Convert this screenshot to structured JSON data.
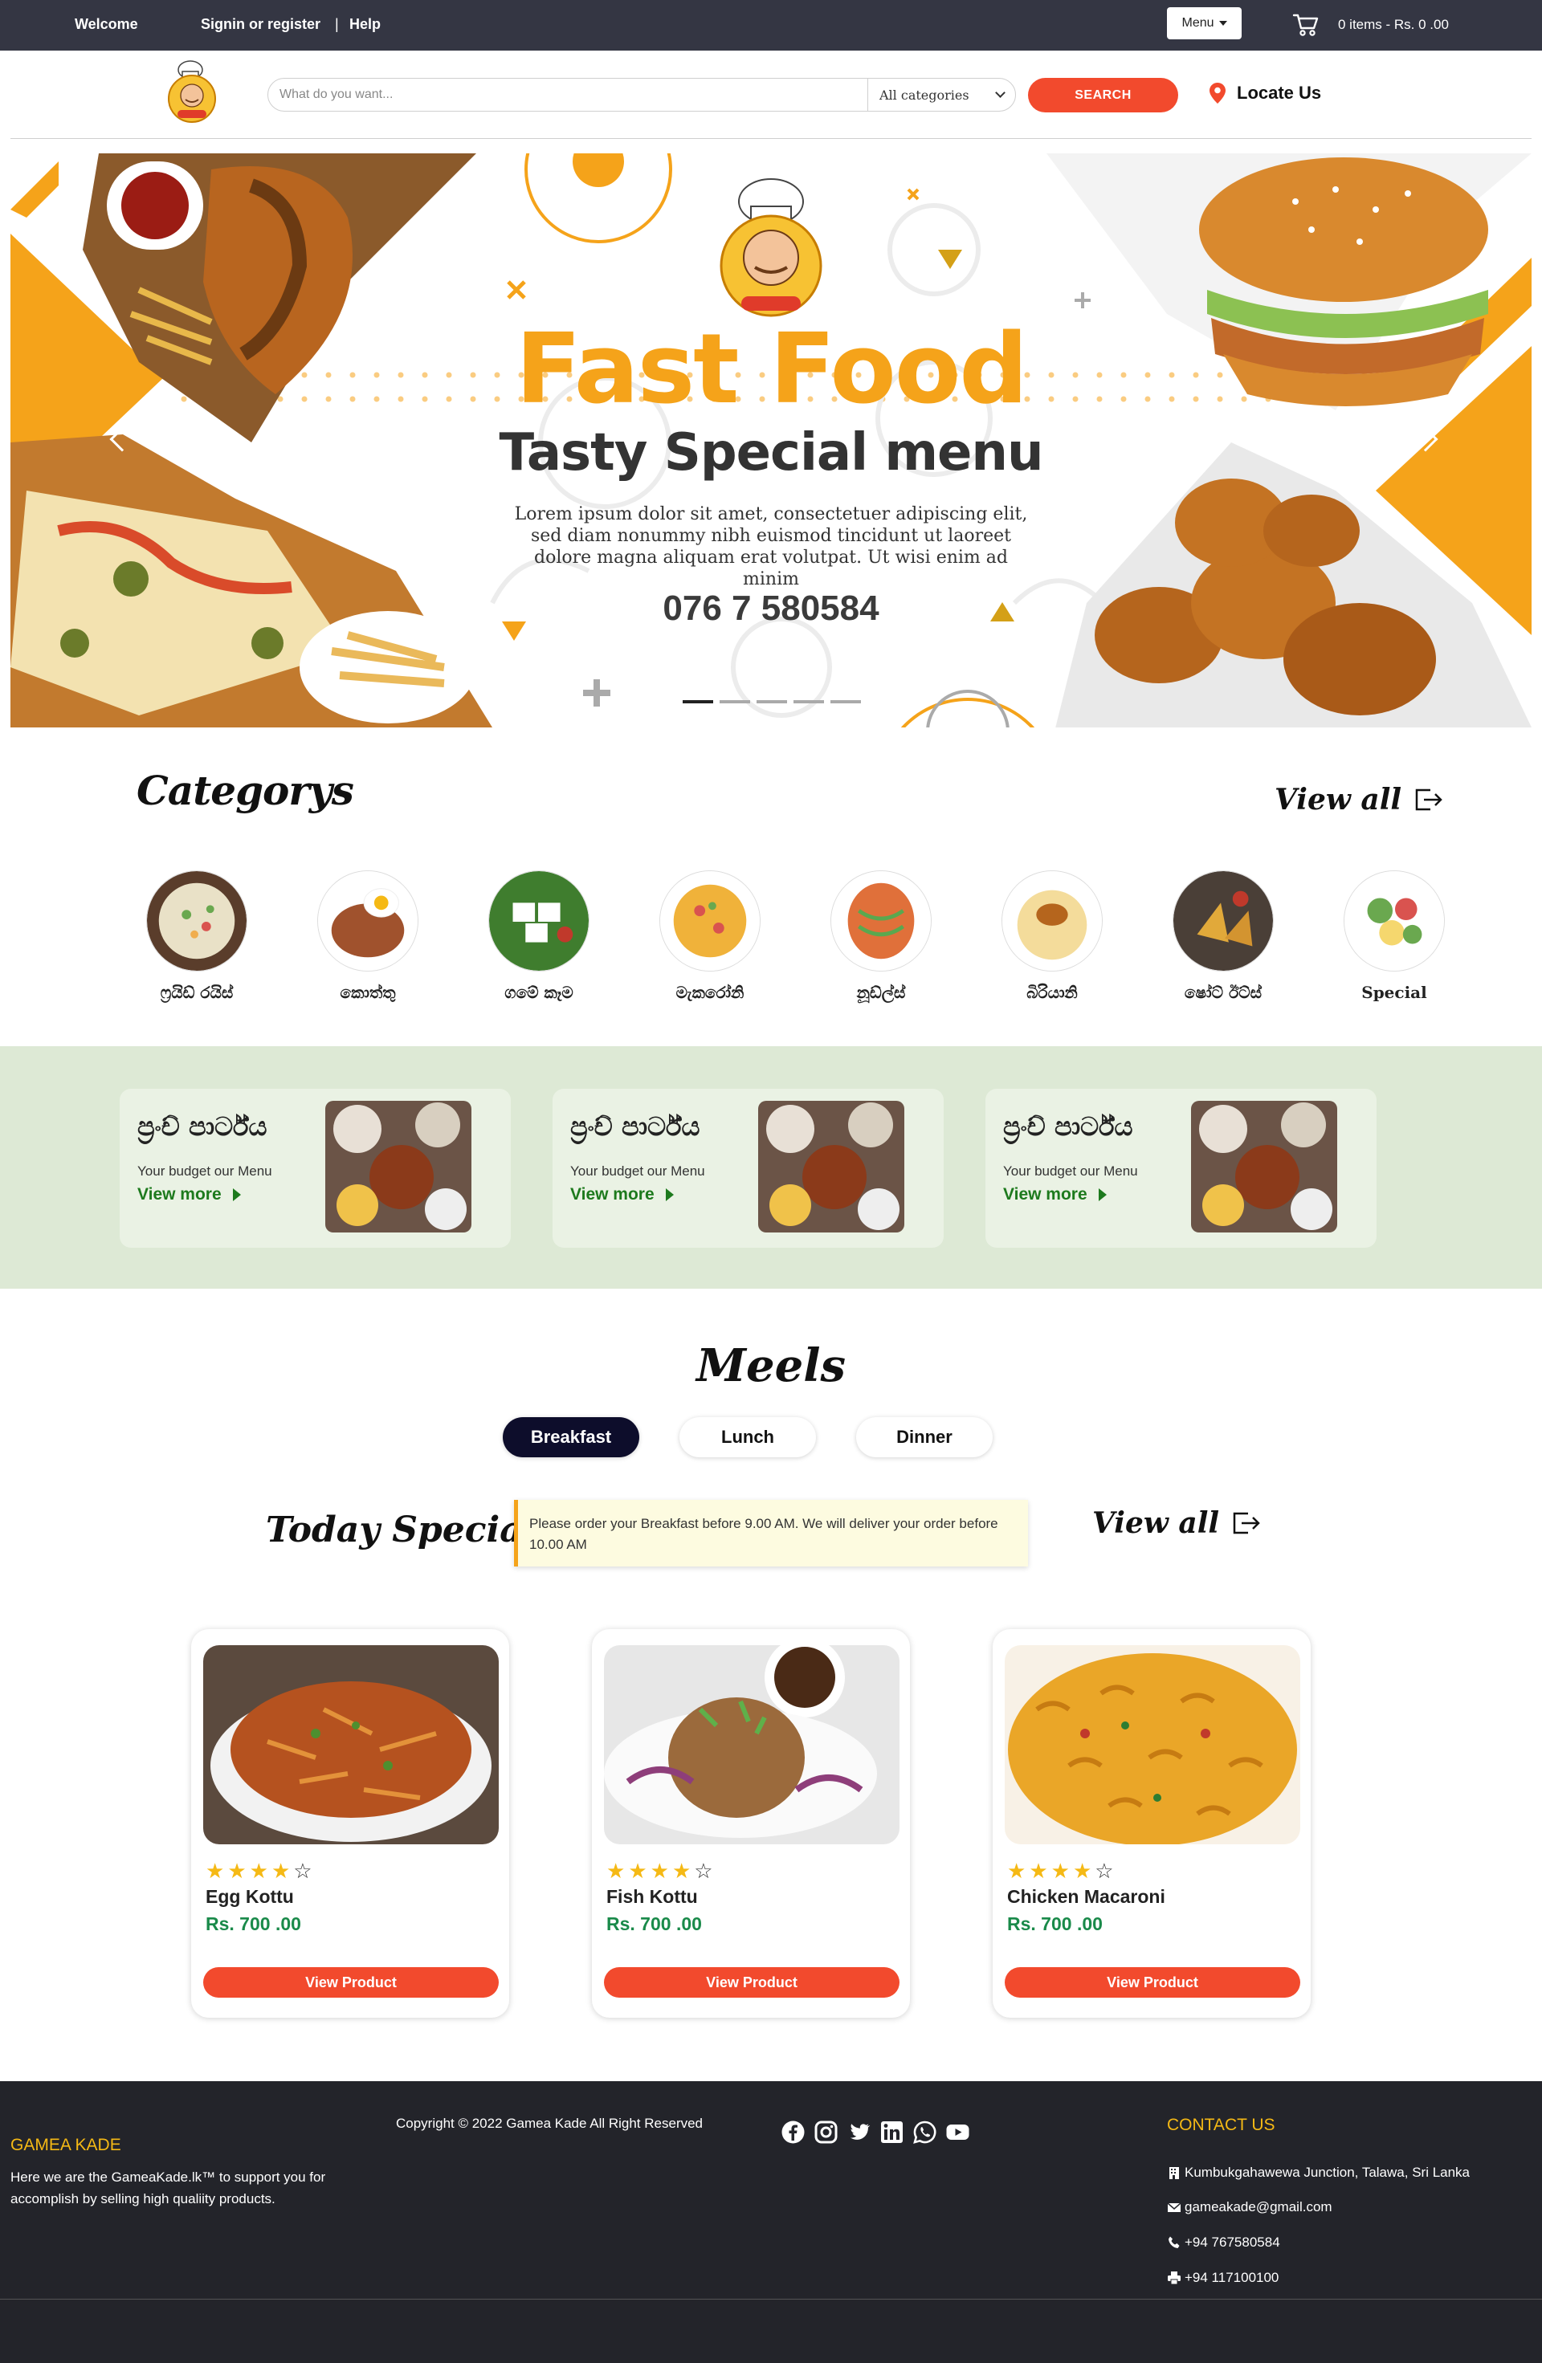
{
  "topbar": {
    "welcome": "Welcome",
    "signin": "Signin or register",
    "separator": "|",
    "help": "Help",
    "menu_label": "Menu",
    "cart_summary": "0 items - Rs. 0 .00"
  },
  "header": {
    "search_placeholder": "What do you want...",
    "category_selected": "All categories",
    "search_button": "SEARCH",
    "locate_label": "Locate Us"
  },
  "hero": {
    "title": "Fast Food",
    "subtitle": "Tasty Special menu",
    "body": "Lorem ipsum dolor sit amet, consectetuer adipiscing elit, sed diam nonummy nibh euismod tincidunt ut laoreet dolore magna aliquam erat volutpat. Ut wisi enim ad minim",
    "phone": "076 7 580584",
    "slides": 5,
    "active_slide": 1
  },
  "categories": {
    "title": "Categorys",
    "view_all": "View all",
    "items": [
      {
        "label": "ෆ්‍රයිඩ් රයිස්"
      },
      {
        "label": "කොත්තු"
      },
      {
        "label": "ගමේ කෑම"
      },
      {
        "label": "මැකරෝනි"
      },
      {
        "label": "නූඩ්ල්ස්"
      },
      {
        "label": "බිරියානි"
      },
      {
        "label": "ෂෝට් ඊට්ස්"
      },
      {
        "label": "Special"
      }
    ]
  },
  "promos": [
    {
      "title": "ප්‍රංච් පාර්ට්ය",
      "subtitle": "Your budget our Menu",
      "link": "View more"
    },
    {
      "title": "ප්‍රංච් පාර්ට්ය",
      "subtitle": "Your budget our Menu",
      "link": "View more"
    },
    {
      "title": "ප්‍රංච් පාර්ට්ය",
      "subtitle": "Your budget our Menu",
      "link": "View more"
    }
  ],
  "meals": {
    "title": "Meels",
    "tabs": [
      {
        "label": "Breakfast",
        "active": true
      },
      {
        "label": "Lunch",
        "active": false
      },
      {
        "label": "Dinner",
        "active": false
      }
    ],
    "today_special": "Today Special",
    "notice": "Please order your Breakfast before 9.00 AM. We will deliver your order before 10.00 AM",
    "view_all": "View all",
    "products": [
      {
        "name": "Egg Kottu",
        "price": "Rs. 700 .00",
        "rating": 4,
        "max_rating": 5,
        "button": "View Product"
      },
      {
        "name": "Fish Kottu",
        "price": "Rs. 700 .00",
        "rating": 4,
        "max_rating": 5,
        "button": "View Product"
      },
      {
        "name": "Chicken Macaroni",
        "price": "Rs. 700 .00",
        "rating": 4,
        "max_rating": 5,
        "button": "View Product"
      }
    ]
  },
  "footer": {
    "brand": "GAMEA KADE",
    "description": "Here we are the GameaKade.lk™ to support you for accomplish by selling high qualiity products.",
    "copyright": "Copyright © 2022 Gamea Kade All Right Reserved",
    "social": [
      "facebook-icon",
      "instagram-icon",
      "twitter-icon",
      "linkedin-icon",
      "whatsapp-icon",
      "youtube-icon"
    ],
    "contact_title": "CONTACT US",
    "address": "Kumbukgahawewa Junction, Talawa, Sri Lanka",
    "email": "gameakade@gmail.com",
    "phone": "+94 767580584",
    "fax": "+94 117100100"
  },
  "colors": {
    "topbar": "#343643",
    "accent_orange": "#f5a31a",
    "button_red": "#f24a2d",
    "promo_band": "#dde9d5",
    "price_green": "#1a8a4a",
    "footer": "#23242a",
    "footer_gold": "#f5b915"
  }
}
